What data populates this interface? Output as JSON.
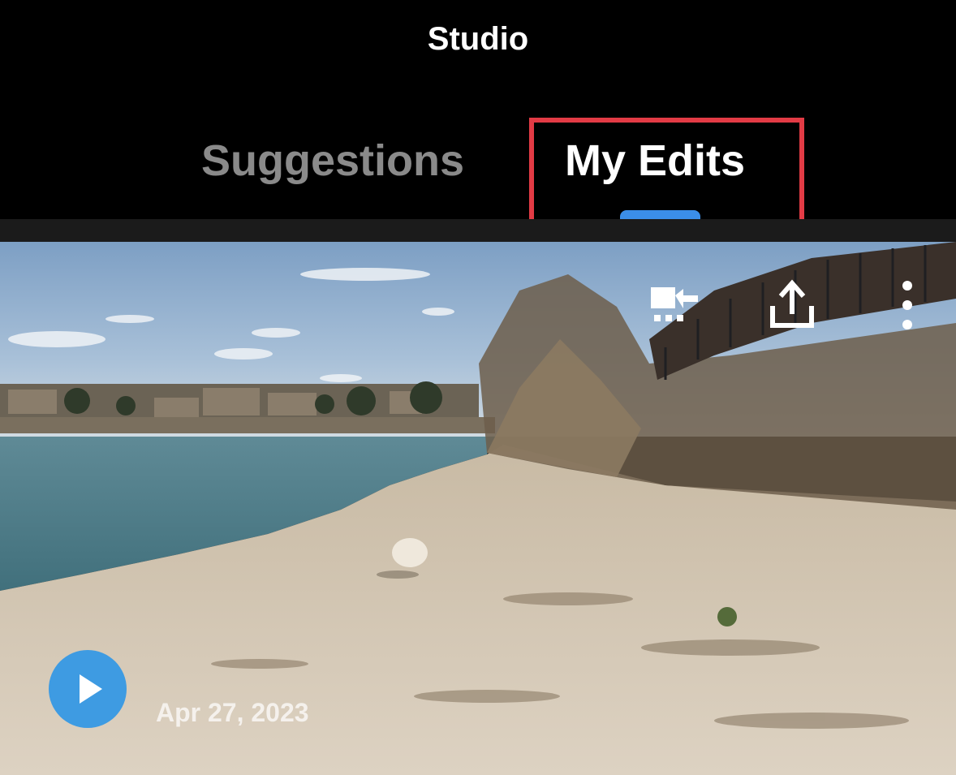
{
  "header": {
    "title": "Studio"
  },
  "tabs": [
    {
      "label": "Suggestions",
      "active": false
    },
    {
      "label": "My Edits",
      "active": true
    }
  ],
  "colors": {
    "background": "#000000",
    "active_tab_indicator": "#3b8ee8",
    "highlight_box": "#e23b45",
    "play_button": "#3e9be2",
    "inactive_tab": "#8a8a8a"
  },
  "media_card": {
    "date": "Apr 27, 2023",
    "actions": [
      {
        "icon": "send-to-editor-icon"
      },
      {
        "icon": "share-icon"
      },
      {
        "icon": "more-vertical-icon"
      }
    ],
    "play_icon": "play-icon"
  }
}
